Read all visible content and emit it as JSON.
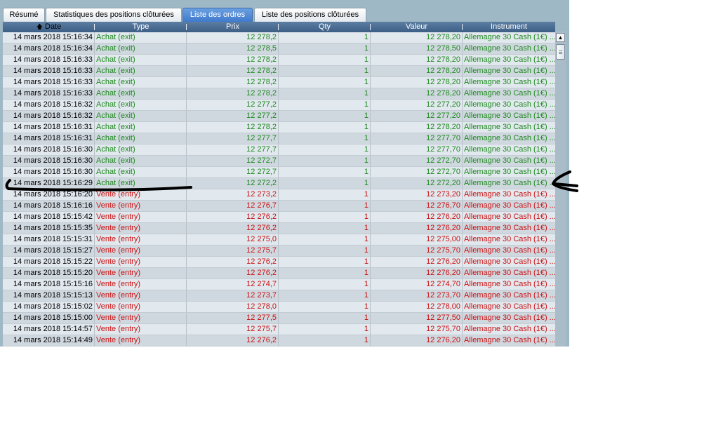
{
  "tabs": [
    {
      "label": "Résumé",
      "active": false
    },
    {
      "label": "Statistiques des positions clôturées",
      "active": false
    },
    {
      "label": "Liste des ordres",
      "active": true
    },
    {
      "label": "Liste des positions clôturées",
      "active": false
    }
  ],
  "columns": [
    "Date",
    "Type",
    "Prix",
    "Qty",
    "Valeur",
    "Instrument"
  ],
  "sort": {
    "column": "Date",
    "icon": "sort-up-arrow-icon"
  },
  "colors": {
    "buy": "#1f8a1f",
    "sell": "#cc1111",
    "header": "#4a6d94",
    "annotation": "#000000"
  },
  "rows": [
    {
      "date": "14 mars 2018 15:16:34",
      "type": "Achat (exit)",
      "prix": "12 278,2",
      "qty": "1",
      "valeur": "12 278,20",
      "instrument": "Allemagne 30 Cash (1€) ...",
      "side": "buy"
    },
    {
      "date": "14 mars 2018 15:16:34",
      "type": "Achat (exit)",
      "prix": "12 278,5",
      "qty": "1",
      "valeur": "12 278,50",
      "instrument": "Allemagne 30 Cash (1€) ...",
      "side": "buy"
    },
    {
      "date": "14 mars 2018 15:16:33",
      "type": "Achat (exit)",
      "prix": "12 278,2",
      "qty": "1",
      "valeur": "12 278,20",
      "instrument": "Allemagne 30 Cash (1€) ...",
      "side": "buy"
    },
    {
      "date": "14 mars 2018 15:16:33",
      "type": "Achat (exit)",
      "prix": "12 278,2",
      "qty": "1",
      "valeur": "12 278,20",
      "instrument": "Allemagne 30 Cash (1€) ...",
      "side": "buy"
    },
    {
      "date": "14 mars 2018 15:16:33",
      "type": "Achat (exit)",
      "prix": "12 278,2",
      "qty": "1",
      "valeur": "12 278,20",
      "instrument": "Allemagne 30 Cash (1€) ...",
      "side": "buy"
    },
    {
      "date": "14 mars 2018 15:16:33",
      "type": "Achat (exit)",
      "prix": "12 278,2",
      "qty": "1",
      "valeur": "12 278,20",
      "instrument": "Allemagne 30 Cash (1€) ...",
      "side": "buy"
    },
    {
      "date": "14 mars 2018 15:16:32",
      "type": "Achat (exit)",
      "prix": "12 277,2",
      "qty": "1",
      "valeur": "12 277,20",
      "instrument": "Allemagne 30 Cash (1€) ...",
      "side": "buy"
    },
    {
      "date": "14 mars 2018 15:16:32",
      "type": "Achat (exit)",
      "prix": "12 277,2",
      "qty": "1",
      "valeur": "12 277,20",
      "instrument": "Allemagne 30 Cash (1€) ...",
      "side": "buy"
    },
    {
      "date": "14 mars 2018 15:16:31",
      "type": "Achat (exit)",
      "prix": "12 278,2",
      "qty": "1",
      "valeur": "12 278,20",
      "instrument": "Allemagne 30 Cash (1€) ...",
      "side": "buy"
    },
    {
      "date": "14 mars 2018 15:16:31",
      "type": "Achat (exit)",
      "prix": "12 277,7",
      "qty": "1",
      "valeur": "12 277,70",
      "instrument": "Allemagne 30 Cash (1€) ...",
      "side": "buy"
    },
    {
      "date": "14 mars 2018 15:16:30",
      "type": "Achat (exit)",
      "prix": "12 277,7",
      "qty": "1",
      "valeur": "12 277,70",
      "instrument": "Allemagne 30 Cash (1€) ...",
      "side": "buy"
    },
    {
      "date": "14 mars 2018 15:16:30",
      "type": "Achat (exit)",
      "prix": "12 272,7",
      "qty": "1",
      "valeur": "12 272,70",
      "instrument": "Allemagne 30 Cash (1€) ...",
      "side": "buy"
    },
    {
      "date": "14 mars 2018 15:16:30",
      "type": "Achat (exit)",
      "prix": "12 272,7",
      "qty": "1",
      "valeur": "12 272,70",
      "instrument": "Allemagne 30 Cash (1€) ...",
      "side": "buy"
    },
    {
      "date": "14 mars 2018 15:16:29",
      "type": "Achat (exit)",
      "prix": "12 272,2",
      "qty": "1",
      "valeur": "12 272,20",
      "instrument": "Allemagne 30 Cash (1€) ...",
      "side": "buy"
    },
    {
      "date": "14 mars 2018 15:16:20",
      "type": "Vente (entry)",
      "prix": "12 273,2",
      "qty": "1",
      "valeur": "12 273,20",
      "instrument": "Allemagne 30 Cash (1€) ...",
      "side": "sell"
    },
    {
      "date": "14 mars 2018 15:16:16",
      "type": "Vente (entry)",
      "prix": "12 276,7",
      "qty": "1",
      "valeur": "12 276,70",
      "instrument": "Allemagne 30 Cash (1€) ...",
      "side": "sell"
    },
    {
      "date": "14 mars 2018 15:15:42",
      "type": "Vente (entry)",
      "prix": "12 276,2",
      "qty": "1",
      "valeur": "12 276,20",
      "instrument": "Allemagne 30 Cash (1€) ...",
      "side": "sell"
    },
    {
      "date": "14 mars 2018 15:15:35",
      "type": "Vente (entry)",
      "prix": "12 276,2",
      "qty": "1",
      "valeur": "12 276,20",
      "instrument": "Allemagne 30 Cash (1€) ...",
      "side": "sell"
    },
    {
      "date": "14 mars 2018 15:15:31",
      "type": "Vente (entry)",
      "prix": "12 275,0",
      "qty": "1",
      "valeur": "12 275,00",
      "instrument": "Allemagne 30 Cash (1€) ...",
      "side": "sell"
    },
    {
      "date": "14 mars 2018 15:15:27",
      "type": "Vente (entry)",
      "prix": "12 275,7",
      "qty": "1",
      "valeur": "12 275,70",
      "instrument": "Allemagne 30 Cash (1€) ...",
      "side": "sell"
    },
    {
      "date": "14 mars 2018 15:15:22",
      "type": "Vente (entry)",
      "prix": "12 276,2",
      "qty": "1",
      "valeur": "12 276,20",
      "instrument": "Allemagne 30 Cash (1€) ...",
      "side": "sell"
    },
    {
      "date": "14 mars 2018 15:15:20",
      "type": "Vente (entry)",
      "prix": "12 276,2",
      "qty": "1",
      "valeur": "12 276,20",
      "instrument": "Allemagne 30 Cash (1€) ...",
      "side": "sell"
    },
    {
      "date": "14 mars 2018 15:15:16",
      "type": "Vente (entry)",
      "prix": "12 274,7",
      "qty": "1",
      "valeur": "12 274,70",
      "instrument": "Allemagne 30 Cash (1€) ...",
      "side": "sell"
    },
    {
      "date": "14 mars 2018 15:15:13",
      "type": "Vente (entry)",
      "prix": "12 273,7",
      "qty": "1",
      "valeur": "12 273,70",
      "instrument": "Allemagne 30 Cash (1€) ...",
      "side": "sell"
    },
    {
      "date": "14 mars 2018 15:15:02",
      "type": "Vente (entry)",
      "prix": "12 278,0",
      "qty": "1",
      "valeur": "12 278,00",
      "instrument": "Allemagne 30 Cash (1€) ...",
      "side": "sell"
    },
    {
      "date": "14 mars 2018 15:15:00",
      "type": "Vente (entry)",
      "prix": "12 277,5",
      "qty": "1",
      "valeur": "12 277,50",
      "instrument": "Allemagne 30 Cash (1€) ...",
      "side": "sell"
    },
    {
      "date": "14 mars 2018 15:14:57",
      "type": "Vente (entry)",
      "prix": "12 275,7",
      "qty": "1",
      "valeur": "12 275,70",
      "instrument": "Allemagne 30 Cash (1€) ...",
      "side": "sell"
    },
    {
      "date": "14 mars 2018 15:14:49",
      "type": "Vente (entry)",
      "prix": "12 276,2",
      "qty": "1",
      "valeur": "12 276,20",
      "instrument": "Allemagne 30 Cash (1€) ...",
      "side": "sell"
    }
  ]
}
